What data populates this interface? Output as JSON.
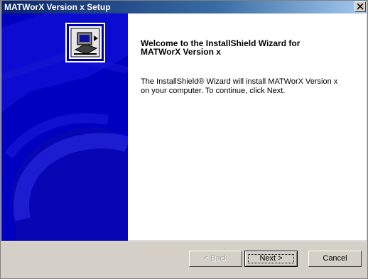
{
  "window": {
    "title": "MATWorX  Version x Setup"
  },
  "welcome": {
    "heading": "Welcome to the InstallShield Wizard for\nMATWorX Version x",
    "body": "The InstallShield® Wizard will install MATWorX Version x\non your computer.  To continue, click Next."
  },
  "buttons": {
    "back": "< Back",
    "next": "Next >",
    "cancel": "Cancel"
  },
  "icons": {
    "close": "close-icon",
    "logo": "installer-computer-icon"
  },
  "colors": {
    "side_panel": "#0000c8",
    "title_bar": "#0a246a",
    "dialog_face": "#d4d0c8"
  }
}
